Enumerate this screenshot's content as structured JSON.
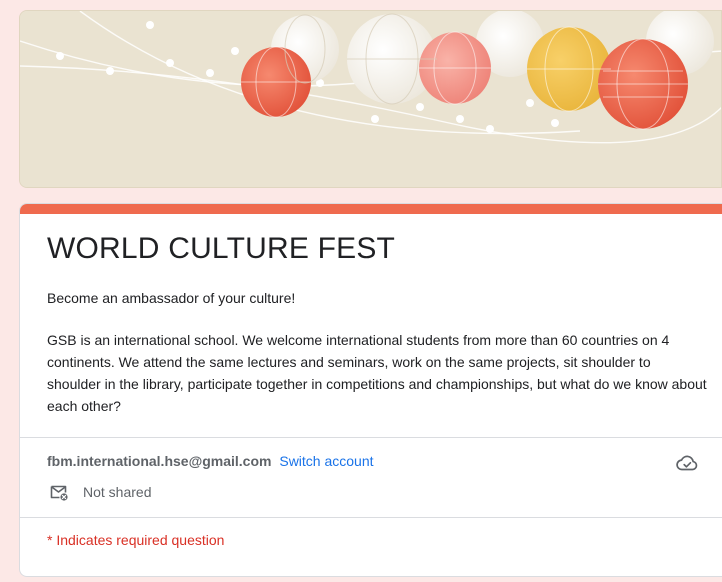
{
  "form": {
    "title": "WORLD CULTURE FEST",
    "subtitle": "Become an ambassador of your culture!",
    "description": "GSB is an international school. We welcome international students from more than 60 countries on 4 continents. We attend the same lectures and seminars, work on the same projects, sit shoulder to shoulder in the library, participate together in competitions and championships, but what do we know about each other?"
  },
  "account": {
    "email": "fbm.international.hse@gmail.com",
    "switch_label": "Switch account",
    "shared_status": "Not shared"
  },
  "required_note": "* Indicates required question",
  "colors": {
    "page_background": "#fce8e6",
    "accent": "#ef6a4e",
    "link": "#1a73e8",
    "required": "#d93025",
    "banner_background": "#eae3d1"
  },
  "icons": {
    "cloud": "cloud-check-icon",
    "mail": "mail-not-shared-icon"
  }
}
